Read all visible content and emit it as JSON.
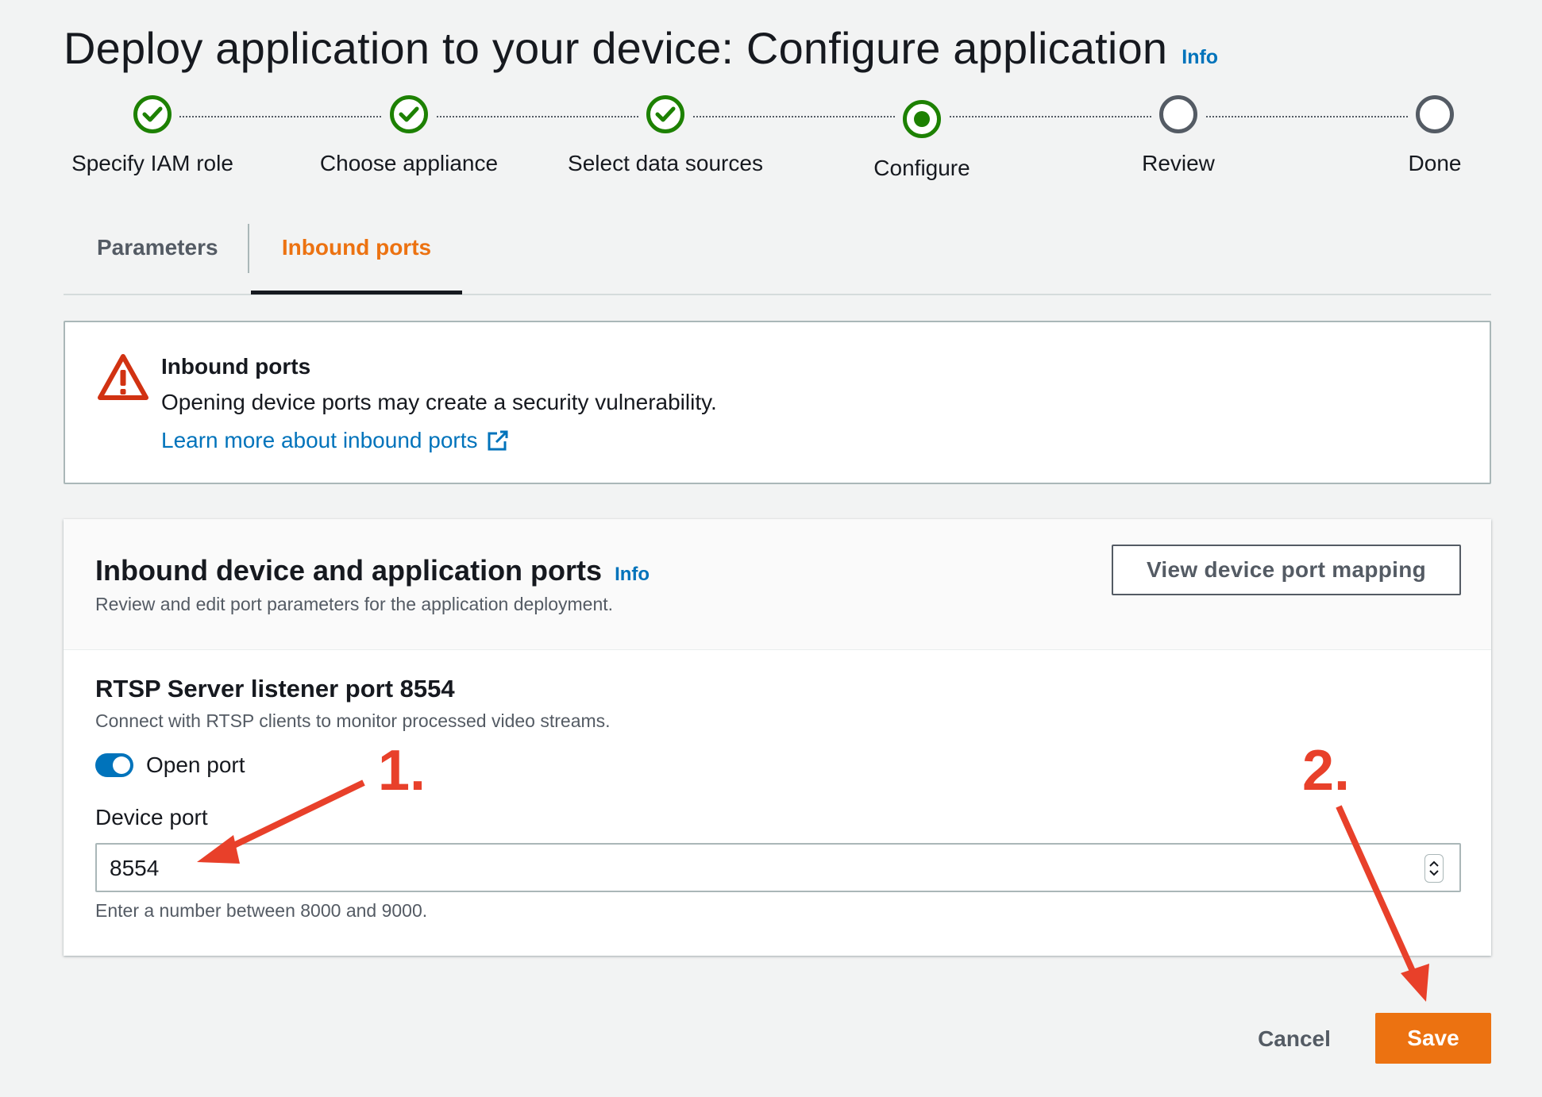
{
  "header": {
    "title": "Deploy application to your device: Configure application",
    "info": "Info"
  },
  "stepper": {
    "steps": [
      {
        "label": "Specify IAM role",
        "state": "done"
      },
      {
        "label": "Choose appliance",
        "state": "done"
      },
      {
        "label": "Select data sources",
        "state": "done"
      },
      {
        "label": "Configure",
        "state": "current"
      },
      {
        "label": "Review",
        "state": "todo"
      },
      {
        "label": "Done",
        "state": "todo"
      }
    ]
  },
  "tabs": {
    "items": [
      {
        "label": "Parameters",
        "active": false
      },
      {
        "label": "Inbound ports",
        "active": true
      }
    ]
  },
  "alert": {
    "icon": "warning-icon",
    "title": "Inbound ports",
    "text": "Opening device ports may create a security vulnerability.",
    "link": "Learn more about inbound ports",
    "link_icon": "external-link-icon"
  },
  "ports_panel": {
    "title": "Inbound device and application ports",
    "info": "Info",
    "description": "Review and edit port parameters for the application deployment.",
    "view_button": "View device port mapping",
    "field": {
      "title": "RTSP Server listener port 8554",
      "description": "Connect with RTSP clients to monitor processed video streams.",
      "toggle_label": "Open port",
      "toggle_on": true,
      "input_label": "Device port",
      "input_value": "8554",
      "hint": "Enter a number between 8000 and 9000."
    }
  },
  "footer": {
    "cancel": "Cancel",
    "save": "Save"
  },
  "annotations": {
    "first": "1.",
    "second": "2.",
    "color": "#e8402a"
  },
  "colors": {
    "success": "#1d8102",
    "link": "#0073bb",
    "primary": "#ec7211",
    "warning": "#d13212"
  }
}
